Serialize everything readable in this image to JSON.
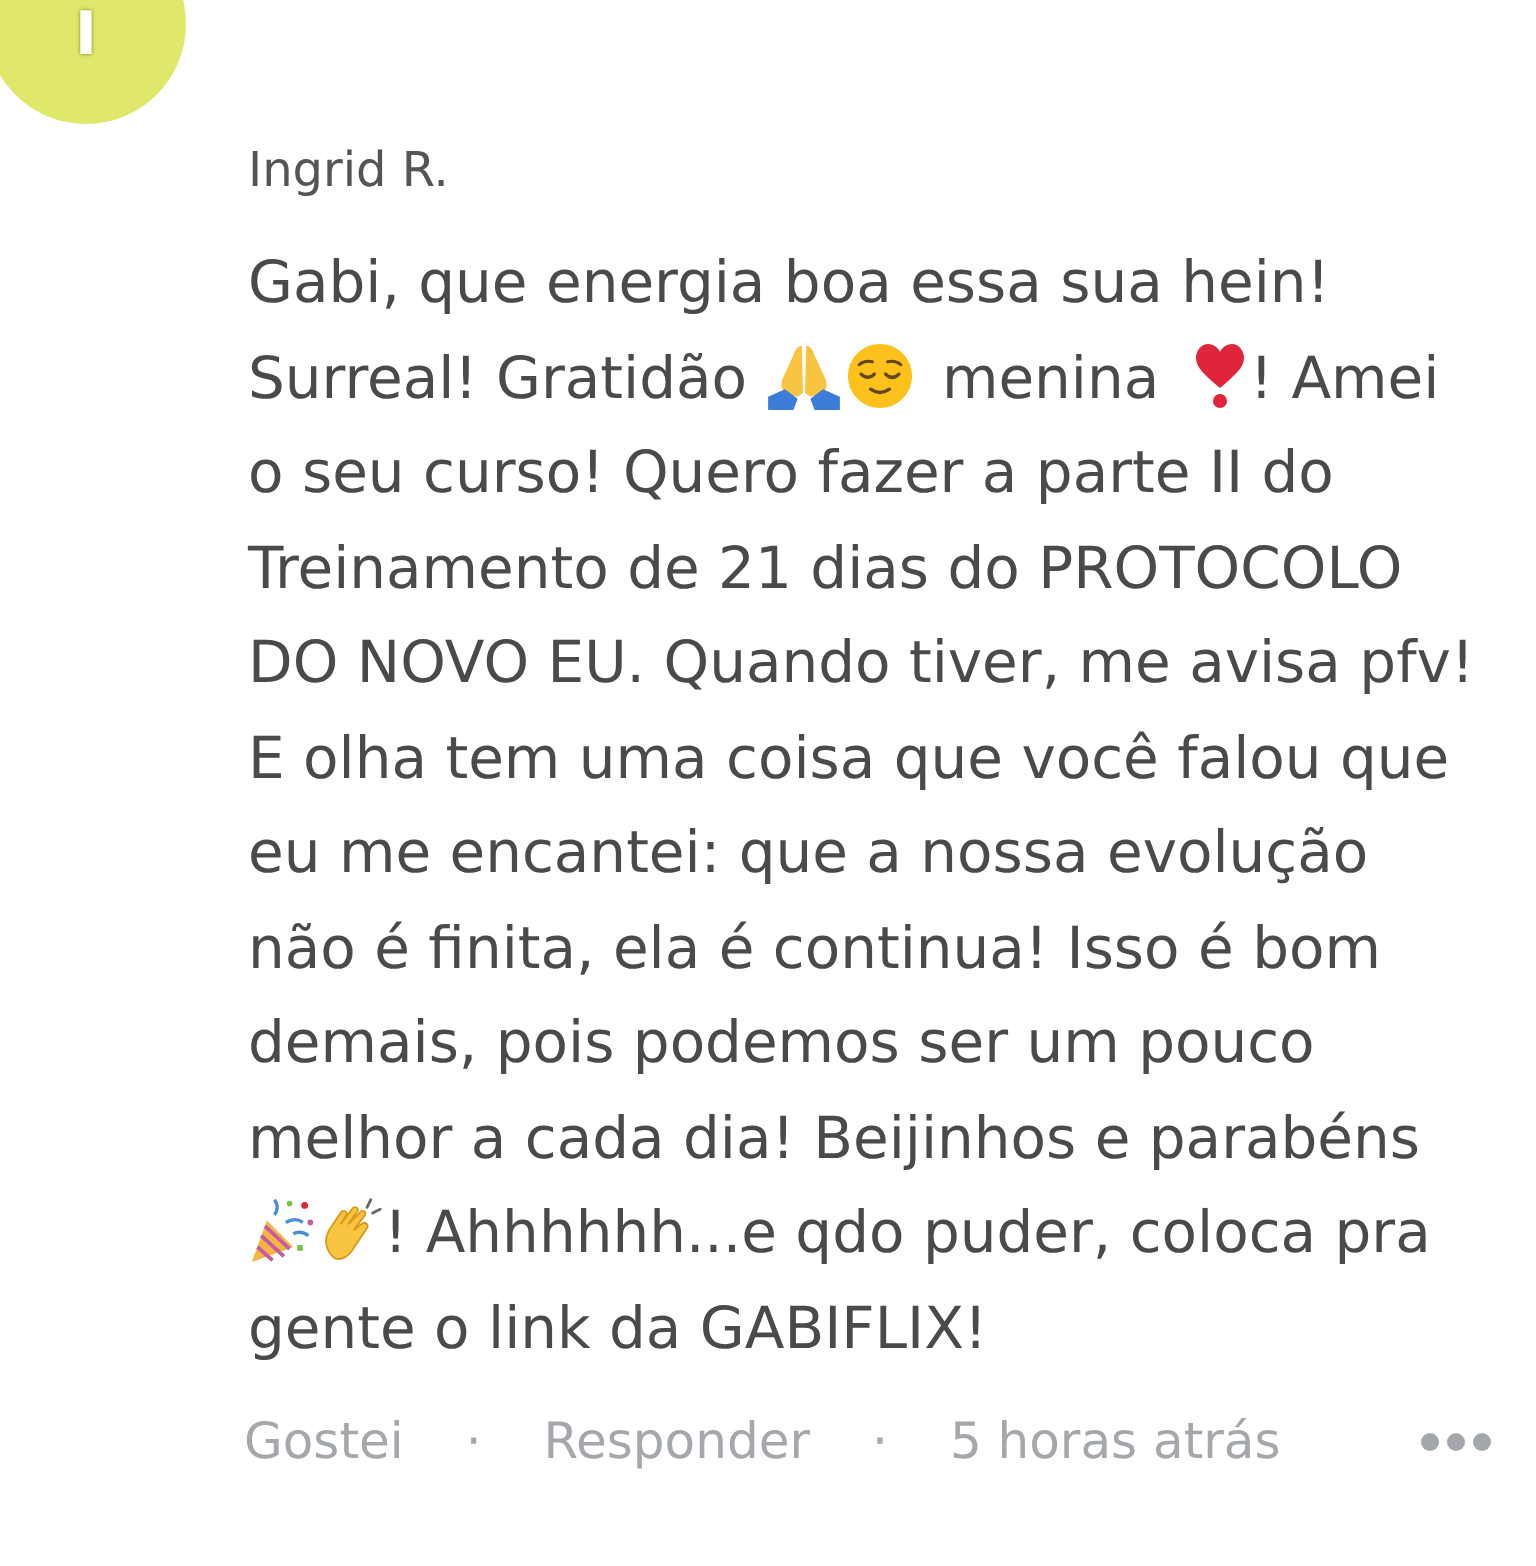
{
  "avatar": {
    "initial": "I"
  },
  "comment": {
    "author": "Ingrid R.",
    "segments": [
      {
        "kind": "text",
        "text": "Gabi, que energia boa essa sua hein! Surreal! Gratidão "
      },
      {
        "kind": "pray"
      },
      {
        "kind": "relieved"
      },
      {
        "kind": "text",
        "text": " menina "
      },
      {
        "kind": "heart"
      },
      {
        "kind": "text",
        "text": "! Amei o seu curso! Quero fazer a parte II do Treinamento de 21 dias do PROTOCOLO DO NOVO EU. Quando tiver, me avisa pfv! E olha tem uma coisa que você falou que eu me encantei: que a nossa evolução não é finita, ela é continua! Isso é bom demais, pois podemos ser um pouco melhor a cada dia! Beijinhos e parabéns "
      },
      {
        "kind": "party"
      },
      {
        "kind": "clap"
      },
      {
        "kind": "text",
        "text": "! Ahhhhhh...e qdo puder, coloca pra gente o link da GABIFLIX!"
      }
    ]
  },
  "actions": {
    "like_button": "Gostei",
    "separators": [
      "·",
      "·"
    ],
    "reply_button": "Responder",
    "timestamp": "5 horas atrás"
  }
}
